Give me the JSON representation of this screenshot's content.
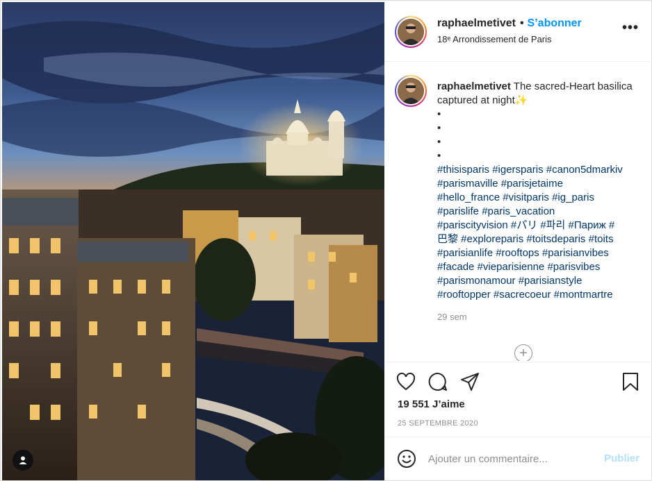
{
  "post": {
    "username": "raphaelmetivet",
    "dot": "•",
    "follow_label": "S’abonner",
    "location": "18ᵉ Arrondissement de Paris",
    "more_label": "•••",
    "caption": {
      "username": "raphaelmetivet",
      "text": "The sacred-Heart basilica captured at night",
      "emoji": "✨",
      "bullets": [
        "•",
        "•",
        "•",
        "•"
      ],
      "hashtags": "#thisisparis #igersparis #canon5dmarkiv\n#parismaville #parisjetaime\n#hello_france #visitparis #ig_paris\n#parislife #paris_vacation\n#pariscityvision #パリ #파리 #Париж #\n巴黎 #exploreparis #toitsdeparis #toits\n#parisianlife #rooftops #parisianvibes\n#facade #vieparisienne #parisvibes\n#parismonamour #parisianstyle\n#rooftopper #sacrecoeur #montmartre",
      "time_ago": "29 sem"
    },
    "load_more_label": "+",
    "likes": "19 551 J’aime",
    "date": "25 SEPTEMBRE 2020",
    "comment_placeholder": "Ajouter un commentaire...",
    "publish_label": "Publier"
  },
  "icons": {
    "like": "heart-icon",
    "comment": "comment-icon",
    "share": "paper-plane-icon",
    "save": "bookmark-icon",
    "emoji": "smiley-icon",
    "more": "more-options-icon",
    "tagged": "user-tag-icon",
    "load_more": "plus-circle-icon"
  },
  "colors": {
    "accent": "#0095f6",
    "hashtag": "#00376b",
    "muted": "#8e8e8e",
    "publish_disabled": "#b2dffc",
    "border": "#dbdbdb"
  }
}
